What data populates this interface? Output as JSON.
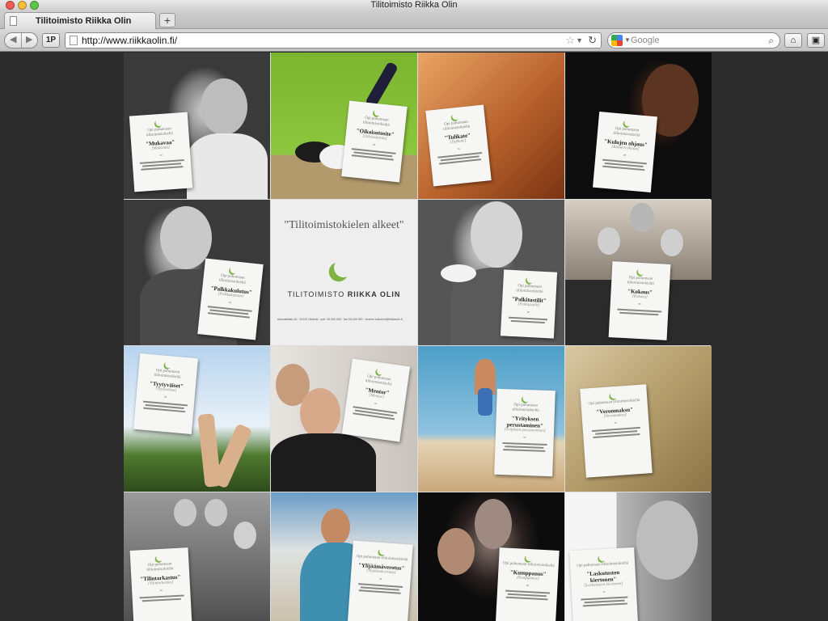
{
  "window": {
    "title": "Tilitoimisto Riikka Olin"
  },
  "tab": {
    "label": "Tilitoimisto Riikka Olin",
    "new_tab": "+"
  },
  "toolbar": {
    "back": "◀",
    "forward": "▶",
    "onep": "1P",
    "url": "http://www.riikkaolin.fi/",
    "search_placeholder": "Google",
    "home": "⌂",
    "bookmark": "▣"
  },
  "logo_tile": {
    "quote": "\"Tilitoimistokielen alkeet\"",
    "name_light": "TILITOIMISTO",
    "name_bold": "RIIKKA OLIN",
    "address": "Ammattikatu 26 · 00120 Helsinki · puh. 09-000 000 · fax 09-000 000 · etunimi.sukunimi@riikkaolin.fi"
  },
  "cards": {
    "intro": "Opi puhumaan tilitoimistokieltä",
    "eq": "=",
    "terms": [
      {
        "term": "\"Mukavaa\"",
        "sub": "[Mukavaa]"
      },
      {
        "term": "\"Oikaisutosite\"",
        "sub": "[Oikaisutosite]"
      },
      {
        "term": "\"Tulikate\"",
        "sub": "[Tulikate]"
      },
      {
        "term": "\"Kulujen ohjaus\"",
        "sub": "[Kulujen ohjaus]"
      },
      {
        "term": "\"Palkkakulutus\"",
        "sub": "[Palkkakulutus]"
      },
      {
        "term": "\"Palkitustilit\"",
        "sub": "[Palkitustilit]"
      },
      {
        "term": "\"Kokous\"",
        "sub": "[Kokous]"
      },
      {
        "term": "\"Tyytyväiset\"",
        "sub": "[Tyytyväiset]"
      },
      {
        "term": "\"Mentor\"",
        "sub": "[Mentor]"
      },
      {
        "term": "\"Yrityksen perustaminen\"",
        "sub": "[Yrityksen perustaminen]"
      },
      {
        "term": "\"Veronmaksu\"",
        "sub": "[Veronmaksu]"
      },
      {
        "term": "\"Tilintarkastus\"",
        "sub": "[Tilintarkastus]"
      },
      {
        "term": "\"Ylijäämäverotus\"",
        "sub": "[Ylijäämäverotus]"
      },
      {
        "term": "\"Kumppanus\"",
        "sub": "[Kumppanus]"
      },
      {
        "term": "\"Laskutusten kiertonen\"",
        "sub": "[Laskutusten kiertonen]"
      }
    ]
  },
  "colors": {
    "accent_moon": "#7cb342",
    "page_bg": "#2c2c2c"
  }
}
